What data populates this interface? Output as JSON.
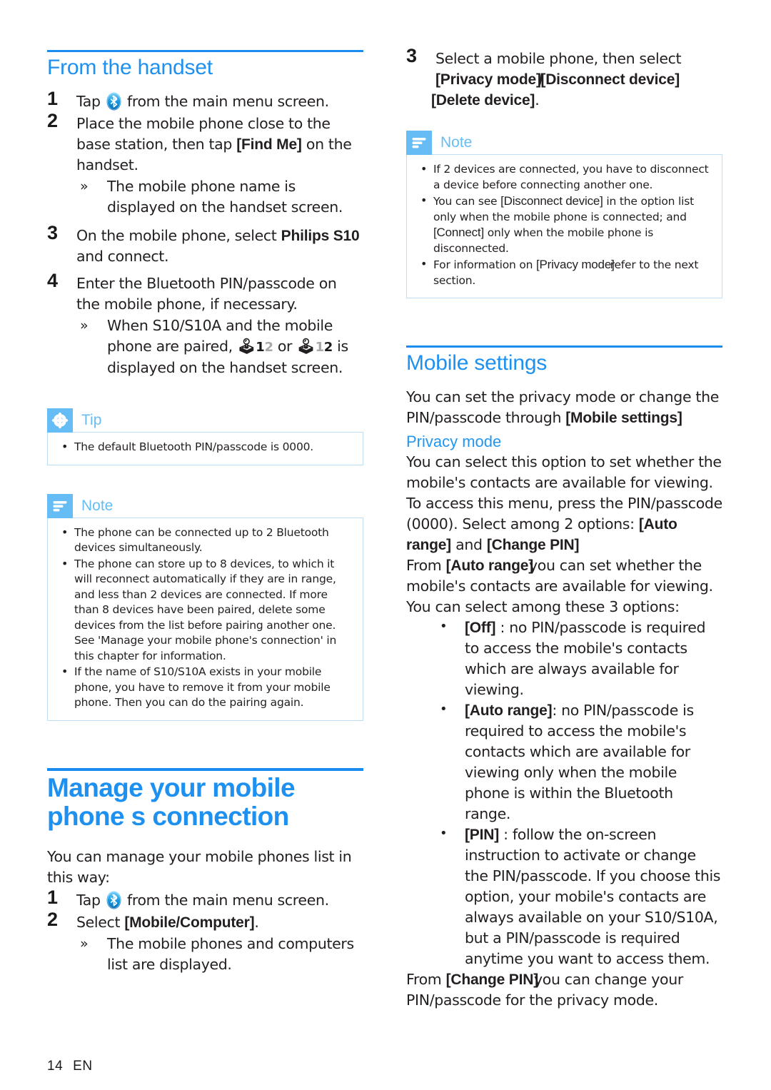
{
  "page": {
    "footer_page_number": "14",
    "footer_language": "EN",
    "accent_heading_color": "#1e90f0",
    "callout_badge_color": "#66bdf5",
    "callout_border_color": "#bcdff7",
    "body_text_color": "#231f20"
  },
  "left_column": {
    "heading": "From the handset",
    "steps": [
      {
        "number": "1",
        "text_before_icon": "Tap",
        "icon": "bluetooth-icon",
        "text_after_icon": "from the main menu screen."
      },
      {
        "number": "2",
        "text": "Place the mobile phone close to the base station, then tap",
        "token": "[Find Me]",
        "text_tail": "on the handset.",
        "sub": "The mobile phone name is displayed on the handset screen."
      },
      {
        "number": "3",
        "text": "On the mobile phone, select",
        "token": "Philips S10",
        "text_tail": "and connect."
      },
      {
        "number": "4",
        "text": "Enter the Bluetooth PIN/passcode on the mobile phone, if necessary.",
        "sub_lead": "When S10/S10A and the mobile phone are paired,",
        "sub_icon_1": "bluetooth-12-icon",
        "sub_middle": "or",
        "sub_icon_2": "bluetooth-12-icon",
        "sub_tail": "is displayed on the handset screen.",
        "paired_digits": [
          "1",
          "2"
        ]
      }
    ],
    "tip": {
      "icon": "asterisk-icon",
      "title": "Tip",
      "items": [
        "The default Bluetooth PIN/passcode is 0000."
      ]
    },
    "note": {
      "icon": "note-lines-icon",
      "title": "Note",
      "items": [
        "The phone can be connected up to 2 Bluetooth devices simultaneously.",
        "The phone can store up to 8 devices, to which it will reconnect automatically if they are in range, and less than 2 devices are connected. If more than 8 devices have been paired, delete some devices from the list before pairing another one. See 'Manage your mobile phone's connection' in this chapter for information.",
        "If the name of S10/S10A exists in your mobile phone, you have to remove it from your mobile phone. Then you can do the pairing again."
      ]
    },
    "manage_section": {
      "heading": "Manage your mobile phone s connection",
      "intro": "You can manage your mobile phones list in this way:",
      "steps": [
        {
          "number": "1",
          "text_before_icon": "Tap",
          "icon": "bluetooth-icon",
          "text_after_icon": "from the main menu screen."
        },
        {
          "number": "2",
          "text": "Select",
          "token": "[Mobile/Computer]",
          "text_tail": ".",
          "sub": "The mobile phones and computers list are displayed."
        }
      ]
    }
  },
  "right_column": {
    "step3": {
      "number": "3",
      "text": "Select a mobile phone, then select",
      "token_1": "[Privacy mode]",
      "separator": "/",
      "token_2": "[Disconnect device]",
      "token_3": "[Delete device]",
      "text_tail": "."
    },
    "note": {
      "icon": "note-lines-icon",
      "title": "Note",
      "items": [
        {
          "parts": [
            {
              "type": "text",
              "value": "If 2 devices are connected, you have to disconnect a device before connecting another one."
            }
          ]
        },
        {
          "parts": [
            {
              "type": "text",
              "value": "You can see "
            },
            {
              "type": "token",
              "value": "[Disconnect device]"
            },
            {
              "type": "text",
              "value": " in the option list only when the mobile phone is connected; and "
            },
            {
              "type": "token",
              "value": "[Connect]"
            },
            {
              "type": "text",
              "value": " only when the mobile phone is disconnected."
            }
          ]
        },
        {
          "parts": [
            {
              "type": "text",
              "value": "For information on "
            },
            {
              "type": "token",
              "value": "[Privacy mode]"
            },
            {
              "type": "text",
              "value": "refer to the next section."
            }
          ]
        }
      ]
    },
    "mobile_settings": {
      "heading": "Mobile settings",
      "intro_lead": "You can set the privacy mode or change the PIN/passcode through",
      "intro_token": "[Mobile settings]",
      "privacy_heading": "Privacy mode",
      "privacy_p1": "You can select this option to set whether the mobile's contacts are available for viewing.",
      "privacy_p2_lead": "To access this menu, press the PIN/passcode (0000). Select among 2 options:",
      "privacy_p2_token1": "[Auto range]",
      "privacy_p2_and": "and",
      "privacy_p2_token2": "[Change PIN]",
      "privacy_p3_lead": "From",
      "privacy_p3_token": "[Auto range]",
      "privacy_p3_tail": "you can set whether the mobile's contacts are available for viewing.",
      "privacy_p4": "You can select among these 3 options:",
      "options": [
        {
          "token": "[Off]",
          "text": " : no PIN/passcode is required to access the mobile's contacts which are always available for viewing."
        },
        {
          "token": "[Auto range]",
          "text": ": no PIN/passcode is required to access the mobile's contacts which are available for viewing only when the mobile phone is within the Bluetooth range."
        },
        {
          "token": "[PIN]",
          "text": " : follow the on-screen instruction to activate or change the PIN/passcode. If you choose this option, your mobile's contacts are always available on your S10/S10A, but a PIN/passcode is required anytime you want to access them."
        }
      ],
      "closing_lead": "From",
      "closing_token": "[Change PIN]",
      "closing_tail": "you can change your PIN/passcode for the privacy mode."
    }
  }
}
